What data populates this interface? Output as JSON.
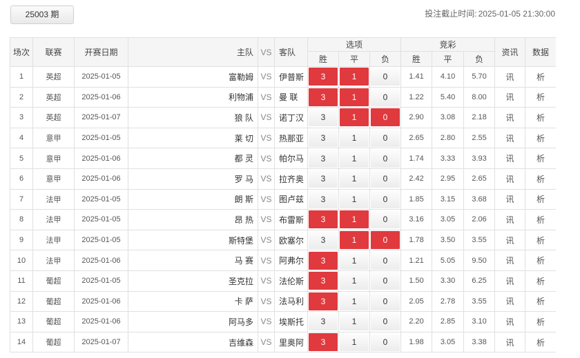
{
  "header": {
    "period_label": "25003 期",
    "deadline_label": "投注截止时间:",
    "deadline_value": "2025-01-05 21:30:00"
  },
  "columns": {
    "index": "场次",
    "league": "联赛",
    "date": "开赛日期",
    "home": "主队",
    "vs": "VS",
    "away": "客队",
    "options": "选项",
    "odds": "竞彩",
    "win": "胜",
    "draw": "平",
    "lose": "负",
    "info": "资讯",
    "data": "数据"
  },
  "colors": {
    "selected": "#e0393e"
  },
  "matches": [
    {
      "idx": "1",
      "league": "英超",
      "date": "2025-01-05",
      "home": "富勒姆",
      "vs": "VS",
      "away": "伊普斯",
      "o3": "3",
      "o1": "1",
      "o0": "0",
      "sel": [
        true,
        true,
        false
      ],
      "w": "1.41",
      "d": "4.10",
      "l": "5.70",
      "info": "讯",
      "data": "析"
    },
    {
      "idx": "2",
      "league": "英超",
      "date": "2025-01-06",
      "home": "利物浦",
      "vs": "VS",
      "away": "曼 联",
      "o3": "3",
      "o1": "1",
      "o0": "0",
      "sel": [
        true,
        true,
        false
      ],
      "w": "1.22",
      "d": "5.40",
      "l": "8.00",
      "info": "讯",
      "data": "析"
    },
    {
      "idx": "3",
      "league": "英超",
      "date": "2025-01-07",
      "home": "狼 队",
      "vs": "VS",
      "away": "诺丁汉",
      "o3": "3",
      "o1": "1",
      "o0": "0",
      "sel": [
        false,
        true,
        true
      ],
      "w": "2.90",
      "d": "3.08",
      "l": "2.18",
      "info": "讯",
      "data": "析"
    },
    {
      "idx": "4",
      "league": "意甲",
      "date": "2025-01-05",
      "home": "莱 切",
      "vs": "VS",
      "away": "热那亚",
      "o3": "3",
      "o1": "1",
      "o0": "0",
      "sel": [
        false,
        false,
        false
      ],
      "w": "2.65",
      "d": "2.80",
      "l": "2.55",
      "info": "讯",
      "data": "析"
    },
    {
      "idx": "5",
      "league": "意甲",
      "date": "2025-01-06",
      "home": "都 灵",
      "vs": "VS",
      "away": "帕尔马",
      "o3": "3",
      "o1": "1",
      "o0": "0",
      "sel": [
        false,
        false,
        false
      ],
      "w": "1.74",
      "d": "3.33",
      "l": "3.93",
      "info": "讯",
      "data": "析"
    },
    {
      "idx": "6",
      "league": "意甲",
      "date": "2025-01-06",
      "home": "罗 马",
      "vs": "VS",
      "away": "拉齐奥",
      "o3": "3",
      "o1": "1",
      "o0": "0",
      "sel": [
        false,
        false,
        false
      ],
      "w": "2.42",
      "d": "2.95",
      "l": "2.65",
      "info": "讯",
      "data": "析"
    },
    {
      "idx": "7",
      "league": "法甲",
      "date": "2025-01-05",
      "home": "朗 斯",
      "vs": "VS",
      "away": "图卢兹",
      "o3": "3",
      "o1": "1",
      "o0": "0",
      "sel": [
        false,
        false,
        false
      ],
      "w": "1.85",
      "d": "3.15",
      "l": "3.68",
      "info": "讯",
      "data": "析"
    },
    {
      "idx": "8",
      "league": "法甲",
      "date": "2025-01-05",
      "home": "昂 热",
      "vs": "VS",
      "away": "布雷斯",
      "o3": "3",
      "o1": "1",
      "o0": "0",
      "sel": [
        true,
        true,
        false
      ],
      "w": "3.16",
      "d": "3.05",
      "l": "2.06",
      "info": "讯",
      "data": "析"
    },
    {
      "idx": "9",
      "league": "法甲",
      "date": "2025-01-05",
      "home": "斯特堡",
      "vs": "VS",
      "away": "欧塞尔",
      "o3": "3",
      "o1": "1",
      "o0": "0",
      "sel": [
        false,
        true,
        true
      ],
      "w": "1.78",
      "d": "3.50",
      "l": "3.55",
      "info": "讯",
      "data": "析"
    },
    {
      "idx": "10",
      "league": "法甲",
      "date": "2025-01-06",
      "home": "马 赛",
      "vs": "VS",
      "away": "阿弗尔",
      "o3": "3",
      "o1": "1",
      "o0": "0",
      "sel": [
        true,
        false,
        false
      ],
      "w": "1.21",
      "d": "5.05",
      "l": "9.50",
      "info": "讯",
      "data": "析"
    },
    {
      "idx": "11",
      "league": "葡超",
      "date": "2025-01-05",
      "home": "圣克拉",
      "vs": "VS",
      "away": "法伦斯",
      "o3": "3",
      "o1": "1",
      "o0": "0",
      "sel": [
        true,
        false,
        false
      ],
      "w": "1.50",
      "d": "3.30",
      "l": "6.25",
      "info": "讯",
      "data": "析"
    },
    {
      "idx": "12",
      "league": "葡超",
      "date": "2025-01-06",
      "home": "卡 萨",
      "vs": "VS",
      "away": "法马利",
      "o3": "3",
      "o1": "1",
      "o0": "0",
      "sel": [
        true,
        false,
        false
      ],
      "w": "2.05",
      "d": "2.78",
      "l": "3.55",
      "info": "讯",
      "data": "析"
    },
    {
      "idx": "13",
      "league": "葡超",
      "date": "2025-01-06",
      "home": "阿马多",
      "vs": "VS",
      "away": "埃斯托",
      "o3": "3",
      "o1": "1",
      "o0": "0",
      "sel": [
        false,
        false,
        false
      ],
      "w": "2.20",
      "d": "2.85",
      "l": "3.10",
      "info": "讯",
      "data": "析"
    },
    {
      "idx": "14",
      "league": "葡超",
      "date": "2025-01-07",
      "home": "吉维森",
      "vs": "VS",
      "away": "里奥阿",
      "o3": "3",
      "o1": "1",
      "o0": "0",
      "sel": [
        true,
        false,
        false
      ],
      "w": "1.98",
      "d": "3.05",
      "l": "3.38",
      "info": "讯",
      "data": "析"
    }
  ]
}
